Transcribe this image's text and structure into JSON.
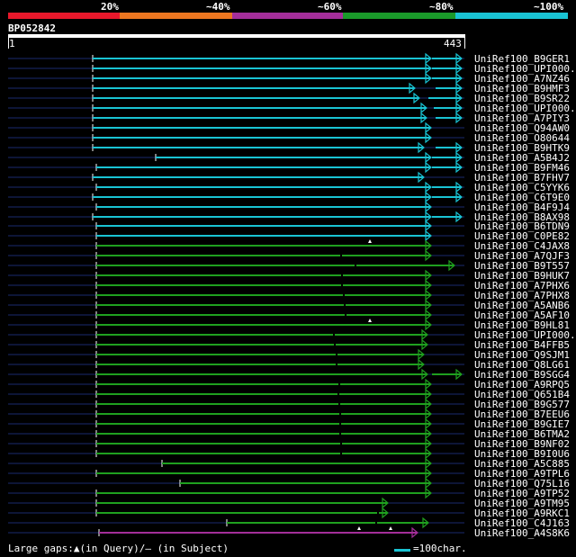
{
  "scale": {
    "labels": [
      "20%",
      "~40%",
      "~60%",
      "~80%",
      "~100%"
    ],
    "colors": [
      "#e8182b",
      "#ec7620",
      "#a42e9a",
      "#1a9a2a",
      "#19c3d3"
    ]
  },
  "query": {
    "name": "BP052842",
    "start": "1",
    "end": "443"
  },
  "colors": {
    "cyan": "#19c3d3",
    "green": "#1fa01f",
    "purple": "#a42e9a",
    "navy": "#1a2a6e",
    "marker": "#ffffff"
  },
  "hits": [
    {
      "label": "UniRef100_B9GER1",
      "color": "cyan"
    },
    {
      "label": "UniRef100_UPI000..",
      "color": "cyan"
    },
    {
      "label": "UniRef100_A7NZ46",
      "color": "cyan"
    },
    {
      "label": "UniRef100_B9HMF3",
      "color": "cyan"
    },
    {
      "label": "UniRef100_B9SR22",
      "color": "cyan"
    },
    {
      "label": "UniRef100_UPI000..",
      "color": "cyan"
    },
    {
      "label": "UniRef100_A7PIY3",
      "color": "cyan"
    },
    {
      "label": "UniRef100_Q94AW0",
      "color": "cyan"
    },
    {
      "label": "UniRef100_O80644",
      "color": "cyan"
    },
    {
      "label": "UniRef100_B9HTK9",
      "color": "cyan"
    },
    {
      "label": "UniRef100_A5B4J2",
      "color": "cyan"
    },
    {
      "label": "UniRef100_B9FM46",
      "color": "cyan"
    },
    {
      "label": "UniRef100_B7FHV7",
      "color": "cyan"
    },
    {
      "label": "UniRef100_C5YYK6",
      "color": "cyan"
    },
    {
      "label": "UniRef100_C6T9E0",
      "color": "cyan"
    },
    {
      "label": "UniRef100_B4F9J4",
      "color": "cyan"
    },
    {
      "label": "UniRef100_B8AX98",
      "color": "cyan"
    },
    {
      "label": "UniRef100_B6TDN9",
      "color": "cyan"
    },
    {
      "label": "UniRef100_C0PE82",
      "color": "cyan"
    },
    {
      "label": "UniRef100_C4JAX8",
      "color": "green"
    },
    {
      "label": "UniRef100_A7QJF3",
      "color": "green"
    },
    {
      "label": "UniRef100_B9T557",
      "color": "green"
    },
    {
      "label": "UniRef100_B9HUK7",
      "color": "green"
    },
    {
      "label": "UniRef100_A7PHX6",
      "color": "green"
    },
    {
      "label": "UniRef100_A7PHX8",
      "color": "green"
    },
    {
      "label": "UniRef100_A5ANB6",
      "color": "green"
    },
    {
      "label": "UniRef100_A5AF10",
      "color": "green"
    },
    {
      "label": "UniRef100_B9HL81",
      "color": "green"
    },
    {
      "label": "UniRef100_UPI000..",
      "color": "green"
    },
    {
      "label": "UniRef100_B4FFB5",
      "color": "green"
    },
    {
      "label": "UniRef100_Q9SJM1",
      "color": "green"
    },
    {
      "label": "UniRef100_Q8LG61",
      "color": "green"
    },
    {
      "label": "UniRef100_B9SGG4",
      "color": "green"
    },
    {
      "label": "UniRef100_A9RPQ5",
      "color": "green"
    },
    {
      "label": "UniRef100_Q651B4",
      "color": "green"
    },
    {
      "label": "UniRef100_B9G577",
      "color": "green"
    },
    {
      "label": "UniRef100_B7EEU6",
      "color": "green"
    },
    {
      "label": "UniRef100_B9GIE7",
      "color": "green"
    },
    {
      "label": "UniRef100_B6TMA2",
      "color": "green"
    },
    {
      "label": "UniRef100_B9NF02",
      "color": "green"
    },
    {
      "label": "UniRef100_B9I0U6",
      "color": "green"
    },
    {
      "label": "UniRef100_A5C885",
      "color": "green"
    },
    {
      "label": "UniRef100_A9TPL6",
      "color": "green"
    },
    {
      "label": "UniRef100_Q75L16",
      "color": "green"
    },
    {
      "label": "UniRef100_A9TP52",
      "color": "green"
    },
    {
      "label": "UniRef100_A9TM95",
      "color": "green"
    },
    {
      "label": "UniRef100_A9RKC1",
      "color": "green"
    },
    {
      "label": "UniRef100_C4J163",
      "color": "green"
    },
    {
      "label": "UniRef100_A4S8K6",
      "color": "purple"
    }
  ],
  "legend": {
    "gaps_text": "Large gaps:▲(in Query)/– (in Subject)",
    "key_text": "=100char."
  }
}
